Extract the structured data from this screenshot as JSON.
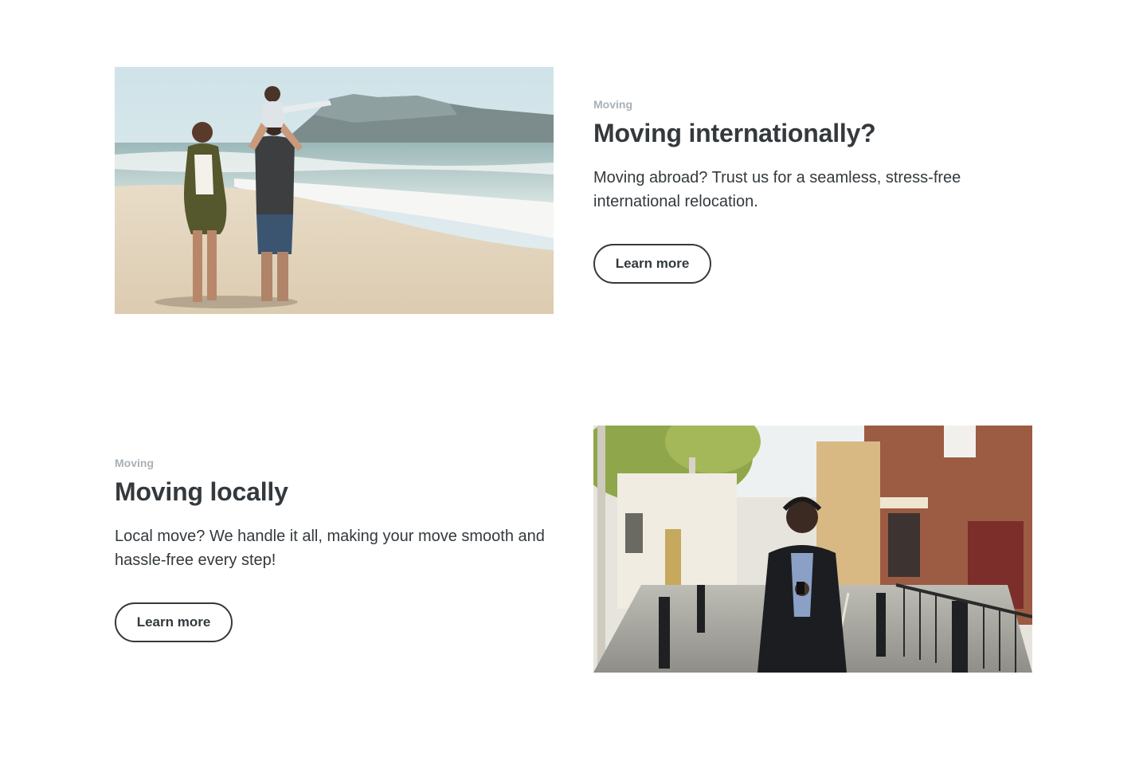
{
  "sections": [
    {
      "eyebrow": "Moving",
      "heading": "Moving internationally?",
      "description": "Moving abroad? Trust us for a seamless, stress-free international relocation.",
      "cta_label": "Learn more",
      "image_subject": "family walking on beach with table mountain"
    },
    {
      "eyebrow": "Moving",
      "heading": "Moving locally",
      "description": "Local move? We handle it all, making your move smooth and hassle-free every step!",
      "cta_label": "Learn more",
      "image_subject": "woman with headphones on city street"
    }
  ],
  "colors": {
    "text": "#33393d",
    "eyebrow": "#a9b1b7",
    "background": "#ffffff"
  }
}
